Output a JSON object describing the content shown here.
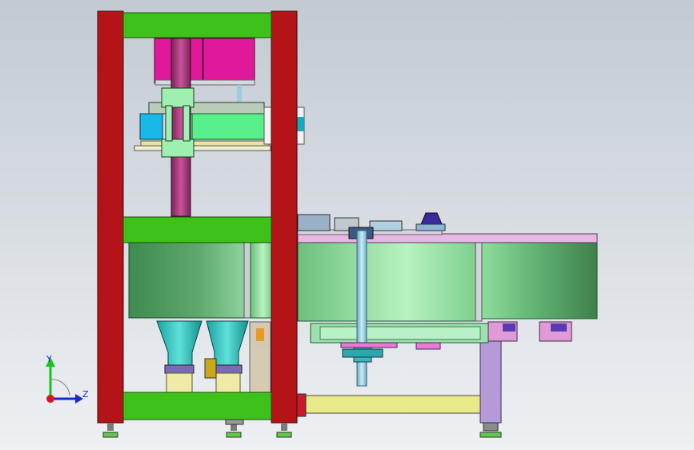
{
  "colors": {
    "frame_red": "#b41418",
    "plate_green": "#3fc11c",
    "drum_green": "#5fa86f",
    "magenta": "#e0189a",
    "cyan": "#18b8e8",
    "rod_blue": "#8ec4d6",
    "table_pink": "#e8b8e4",
    "bg_top": "#c2cad2",
    "bg_bottom": "#eef0f3"
  },
  "triad": {
    "y_label": "Y",
    "z_label": "Z",
    "x_icon": "x-axis-arrow-icon",
    "y_icon": "y-axis-arrow-icon",
    "z_icon": "z-axis-arrow-icon"
  }
}
